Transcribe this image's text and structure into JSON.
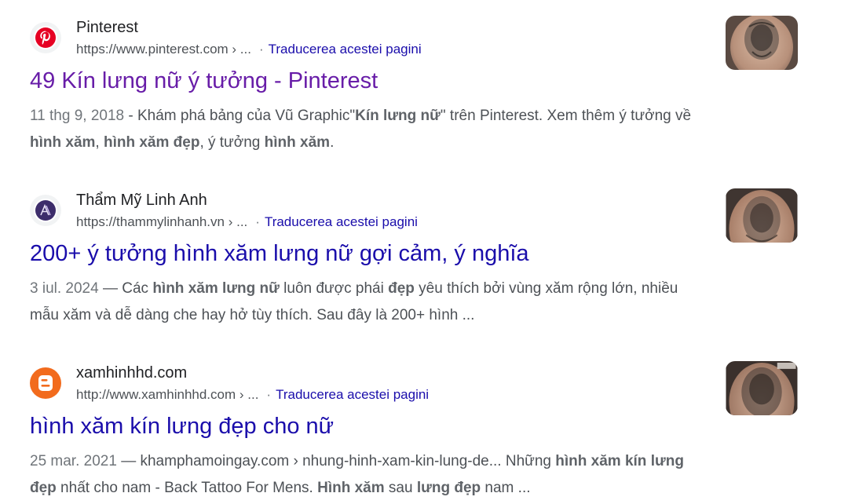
{
  "results": [
    {
      "site_name": "Pinterest",
      "url": "https://www.pinterest.com › ...",
      "separator": "·",
      "translate_label": "Traducerea acestei pagini",
      "title": "49 Kín lưng nữ ý tưởng - Pinterest",
      "snippet": {
        "date": "11 thg 9, 2018",
        "p1": " - Khám phá bảng của Vũ Graphic\"",
        "b1": "Kín lưng nữ",
        "p2": "\" trên Pinterest. Xem thêm ý tưởng về ",
        "b2": "hình xăm",
        "p3": ", ",
        "b3": "hình xăm đẹp",
        "p4": ", ý tưởng ",
        "b4": "hình xăm",
        "p5": "."
      },
      "favicon_icon": "pinterest-logo-icon",
      "favicon_color": "#e60023"
    },
    {
      "site_name": "Thẩm Mỹ Linh Anh",
      "url": "https://thammylinhanh.vn › ...",
      "separator": "·",
      "translate_label": "Traducerea acestei pagini",
      "title": "200+ ý tưởng hình xăm lưng nữ gợi cảm, ý nghĩa",
      "snippet": {
        "date": "3 iul. 2024",
        "p1": " — Các ",
        "b1": "hình xăm lưng nữ",
        "p2": " luôn được phái ",
        "b2": "đẹp",
        "p3": " yêu thích bởi vùng xăm rộng lớn, nhiều mẫu xăm và dễ dàng che hay hở tùy thích. Sau đây là 200+ hình ..."
      },
      "favicon_icon": "linh-anh-logo-icon",
      "favicon_color": "#3d2d6b"
    },
    {
      "site_name": "xamhinhhd.com",
      "url": "http://www.xamhinhhd.com › ...",
      "separator": "·",
      "translate_label": "Traducerea acestei pagini",
      "title": "hình xăm kín lưng đẹp cho nữ",
      "snippet": {
        "date": "25 mar. 2021",
        "p1": " — khamphamoingay.com › nhung-hinh-xam-kin-lung-de... Những ",
        "b1": "hình xăm kín lưng đẹp",
        "p2": " nhất cho nam - Back Tattoo For Mens. ",
        "b2": "Hình xăm",
        "p3": " sau ",
        "b3": "lưng đẹp",
        "p4": " nam ..."
      },
      "favicon_icon": "blogger-logo-icon",
      "favicon_color": "#f26b1d"
    }
  ],
  "colors": {
    "link": "#1a0dab",
    "visited": "#681da8",
    "text": "#4d5156"
  }
}
